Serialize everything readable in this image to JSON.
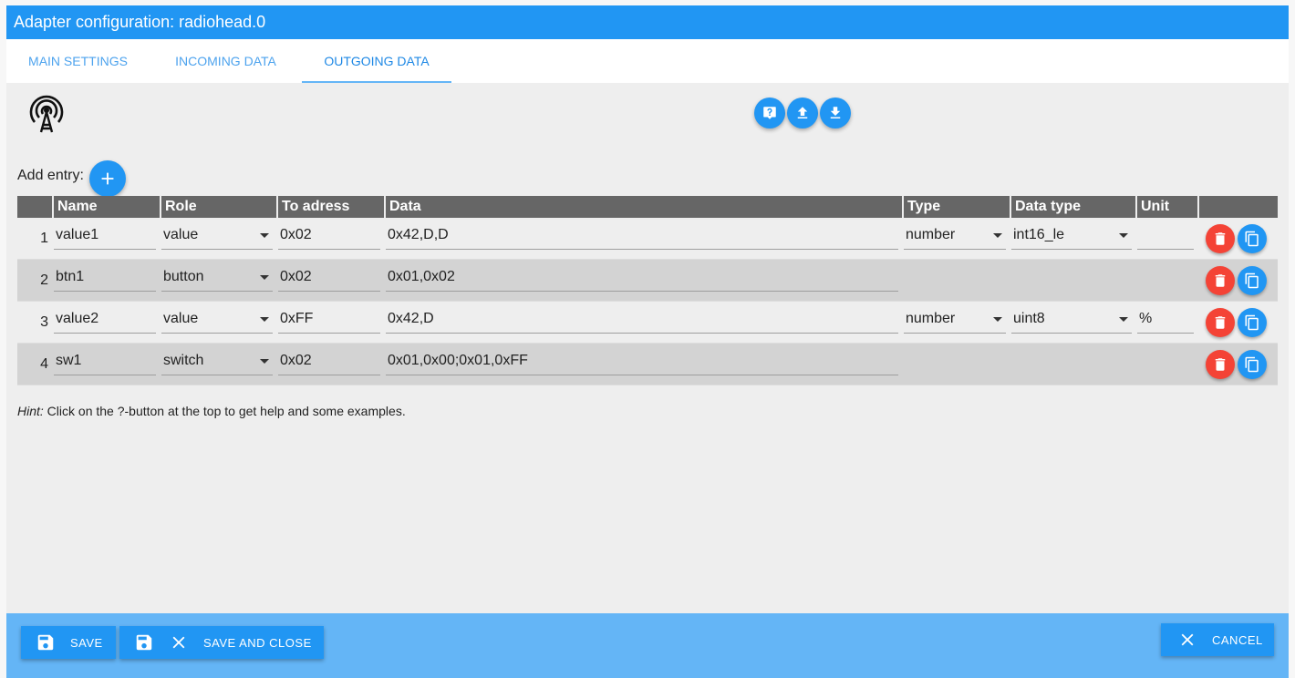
{
  "window": {
    "title": "Adapter configuration: radiohead.0"
  },
  "tabs": [
    {
      "label": "MAIN SETTINGS"
    },
    {
      "label": "INCOMING DATA"
    },
    {
      "label": "OUTGOING DATA",
      "active": true
    }
  ],
  "toolbar": {
    "help_icon": "help-icon",
    "upload_icon": "upload-icon",
    "download_icon": "download-icon"
  },
  "add_entry": {
    "label": "Add entry:"
  },
  "table": {
    "headers": [
      "Name",
      "Role",
      "To adress",
      "Data",
      "Type",
      "Data type",
      "Unit"
    ],
    "rows": [
      {
        "num": "1",
        "name": "value1",
        "role": "value",
        "to": "0x02",
        "data": "0x42,D,D",
        "type": "number",
        "dtype": "int16_le",
        "unit": ""
      },
      {
        "num": "2",
        "name": "btn1",
        "role": "button",
        "to": "0x02",
        "data": "0x01,0x02",
        "type": "",
        "dtype": "",
        "unit": ""
      },
      {
        "num": "3",
        "name": "value2",
        "role": "value",
        "to": "0xFF",
        "data": "0x42,D",
        "type": "number",
        "dtype": "uint8",
        "unit": "%"
      },
      {
        "num": "4",
        "name": "sw1",
        "role": "switch",
        "to": "0x02",
        "data": "0x01,0x00;0x01,0xFF",
        "type": "",
        "dtype": "",
        "unit": ""
      }
    ]
  },
  "hint": {
    "prefix": "Hint:",
    "text": " Click on the ?-button at the top to get help and some examples."
  },
  "footer": {
    "save": "SAVE",
    "save_close": "SAVE AND CLOSE",
    "cancel": "CANCEL"
  },
  "colors": {
    "primary": "#2196f3",
    "danger": "#f44336",
    "footer_bg": "#64b5f6",
    "header_bg": "#666666"
  }
}
